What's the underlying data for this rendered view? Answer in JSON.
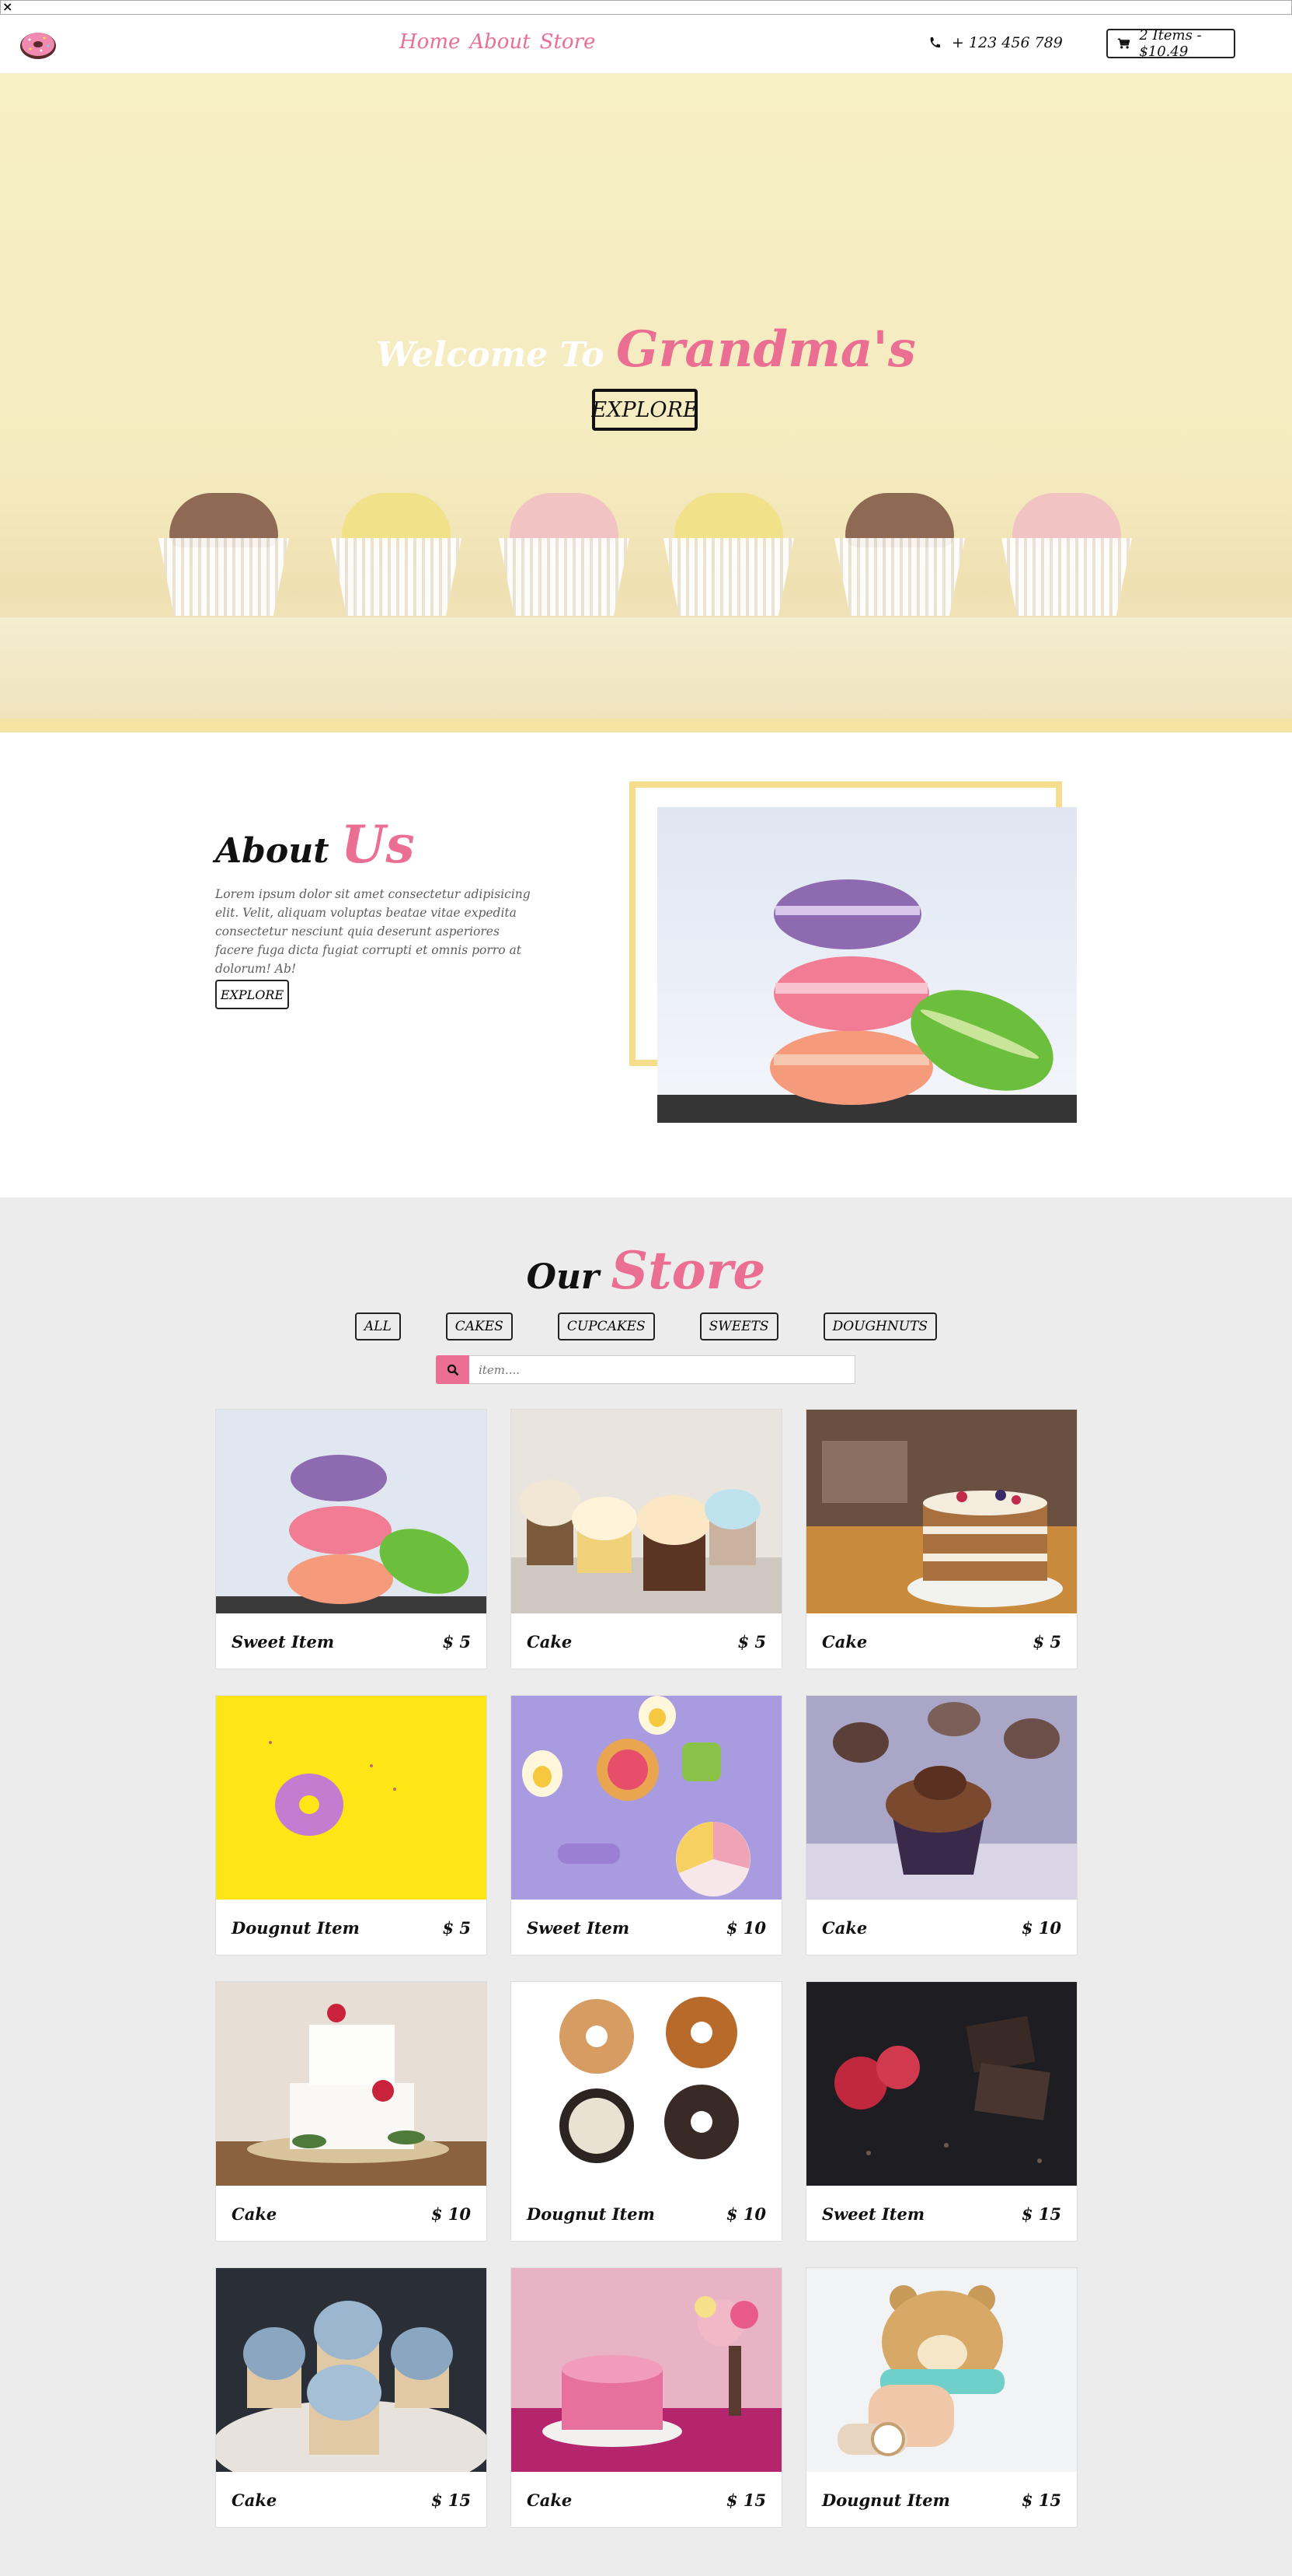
{
  "window": {
    "close_glyph": "×"
  },
  "nav": {
    "links": [
      "Home",
      "About",
      "Store"
    ],
    "phone": "+ 123 456 789",
    "cart": "2 Items - $10.49"
  },
  "hero": {
    "welcome": "Welcome To",
    "brand": "Grandma's",
    "button": "EXPLORE"
  },
  "about": {
    "title": "About",
    "title_accent": "Us",
    "text": "Lorem ipsum dolor sit amet consectetur adipisicing elit. Velit, aliquam voluptas beatae vitae expedita consectetur nesciunt quia deserunt asperiores facere fuga dicta fugiat corrupti et omnis porro at dolorum! Ab!",
    "button": "EXPLORE"
  },
  "store": {
    "title": "Our",
    "title_accent": "Store",
    "filters": [
      "ALL",
      "CAKES",
      "CUPCAKES",
      "SWEETS",
      "DOUGHNUTS"
    ],
    "search_placeholder": "item....",
    "items": [
      {
        "name": "Sweet Item",
        "price": "$ 5",
        "image": "macarons"
      },
      {
        "name": "Cake",
        "price": "$ 5",
        "image": "cupcakes"
      },
      {
        "name": "Cake",
        "price": "$ 5",
        "image": "naked-cake"
      },
      {
        "name": "Dougnut Item",
        "price": "$ 5",
        "image": "doughnut-yellow"
      },
      {
        "name": "Sweet Item",
        "price": "$ 10",
        "image": "candy-purple"
      },
      {
        "name": "Cake",
        "price": "$ 10",
        "image": "chocolate-cupcake"
      },
      {
        "name": "Cake",
        "price": "$ 10",
        "image": "wedding-cake"
      },
      {
        "name": "Dougnut Item",
        "price": "$ 10",
        "image": "four-doughnuts"
      },
      {
        "name": "Sweet Item",
        "price": "$ 15",
        "image": "chocolate-raspberry"
      },
      {
        "name": "Cake",
        "price": "$ 15",
        "image": "blue-cupcakes"
      },
      {
        "name": "Cake",
        "price": "$ 15",
        "image": "pink-cake"
      },
      {
        "name": "Dougnut Item",
        "price": "$ 15",
        "image": "bear-doughnut"
      }
    ]
  },
  "colors": {
    "accent": "#ea6f93",
    "hero_bg": "#f6ecc4",
    "store_bg": "#ececec",
    "frame": "#f5dd8c"
  }
}
